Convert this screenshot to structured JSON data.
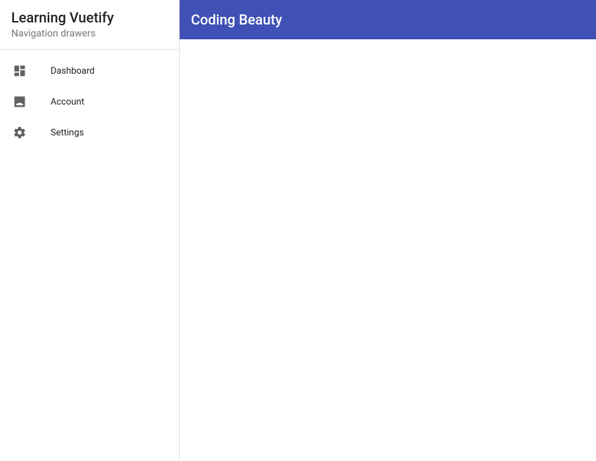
{
  "sidebar": {
    "title": "Learning Vuetify",
    "subtitle": "Navigation drawers",
    "items": [
      {
        "label": "Dashboard",
        "icon": "dashboard-icon"
      },
      {
        "label": "Account",
        "icon": "account-icon"
      },
      {
        "label": "Settings",
        "icon": "settings-icon"
      }
    ]
  },
  "header": {
    "title": "Coding Beauty"
  }
}
